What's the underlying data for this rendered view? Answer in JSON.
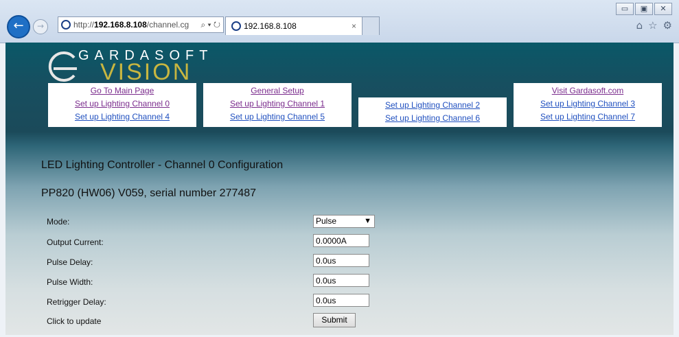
{
  "browser": {
    "url_prefix": "http://",
    "url_host": "192.168.8.108",
    "url_path": "/channel.cg",
    "url_icons": "⌕ ▾ ↻",
    "tab_title": "192.168.8.108",
    "tab_close": "×",
    "window_controls": [
      "▭",
      "▣",
      "✕"
    ],
    "toolbar_icons": [
      "⌂",
      "☆",
      "⚙"
    ]
  },
  "logo": {
    "line1": "GARDASOFT",
    "line2": "VISION"
  },
  "nav": {
    "col1": [
      "Go To Main Page",
      "Set up Lighting Channel 0",
      "Set up Lighting Channel 4"
    ],
    "col2": [
      "General Setup",
      "Set up Lighting Channel 1",
      "Set up Lighting Channel 5"
    ],
    "col3": [
      "Set up Lighting Channel 2",
      "Set up Lighting Channel 6"
    ],
    "col4": [
      "Visit Gardasoft.com",
      "Set up Lighting Channel 3",
      "Set up Lighting Channel 7"
    ]
  },
  "heading": "LED Lighting Controller - Channel 0 Configuration",
  "device": "PP820 (HW06) V059, serial number 277487",
  "form": {
    "mode_label": "Mode:",
    "mode_value": "Pulse",
    "output_current_label": "Output Current:",
    "output_current_value": "0.0000A",
    "pulse_delay_label": "Pulse Delay:",
    "pulse_delay_value": "0.0us",
    "pulse_width_label": "Pulse Width:",
    "pulse_width_value": "0.0us",
    "retrigger_delay_label": "Retrigger Delay:",
    "retrigger_delay_value": "0.0us",
    "update_label": "Click to update",
    "submit_label": "Submit"
  }
}
